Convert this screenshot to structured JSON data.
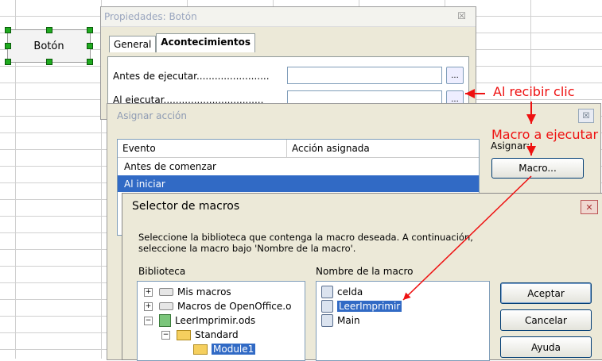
{
  "sheet": {
    "button_label": "Botón"
  },
  "properties_dialog": {
    "title": "Propiedades: Botón",
    "close_glyph": "☒",
    "tabs": [
      "General",
      "Acontecimientos"
    ],
    "rows": [
      {
        "label": "Antes de ejecutar........................",
        "button": "..."
      },
      {
        "label": "Al ejecutar.................................",
        "button": "..."
      }
    ]
  },
  "assign_dialog": {
    "title": "Asignar acción",
    "close_glyph": "☒",
    "columns": [
      "Evento",
      "Acción asignada"
    ],
    "events": [
      "Antes de comenzar",
      "Al iniciar"
    ],
    "assign_label": "Asignar:",
    "macro_button": "Macro..."
  },
  "selector_dialog": {
    "title": "Selector de macros",
    "close_glyph": "✕",
    "description_line1": "Seleccione la biblioteca que contenga la macro deseada. A continuación,",
    "description_line2": "seleccione la macro bajo 'Nombre de la macro'.",
    "library_label": "Biblioteca",
    "macro_name_label": "Nombre de la macro",
    "libraries": [
      {
        "label": "Mis macros",
        "expander": "+"
      },
      {
        "label": "Macros de OpenOffice.o",
        "expander": "+"
      },
      {
        "label": "LeerImprimir.ods",
        "expander": "−"
      },
      {
        "label": "Standard",
        "expander": "−"
      },
      {
        "label": "Module1",
        "expander": ""
      }
    ],
    "macros": [
      "celda",
      "LeerImprimir",
      "Main"
    ],
    "buttons": {
      "ok": "Aceptar",
      "cancel": "Cancelar",
      "help": "Ayuda"
    }
  },
  "annotations": {
    "on_click": "Al recibir clic",
    "macro_to_run": "Macro a ejecutar"
  },
  "colors": {
    "annotation": "#ee1111",
    "selection": "#316ac5",
    "dialog_bg": "#ece9d8"
  }
}
